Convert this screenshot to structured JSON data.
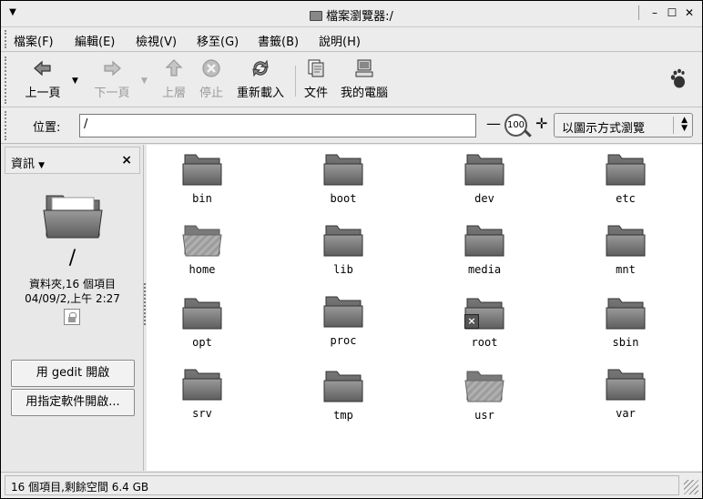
{
  "window": {
    "title": "檔案瀏覽器:/"
  },
  "menubar": {
    "items": [
      {
        "label": "檔案(F)"
      },
      {
        "label": "編輯(E)"
      },
      {
        "label": "檢視(V)"
      },
      {
        "label": "移至(G)"
      },
      {
        "label": "書籤(B)"
      },
      {
        "label": "說明(H)"
      }
    ]
  },
  "toolbar": {
    "back": "上一頁",
    "forward": "下一頁",
    "up": "上層",
    "stop": "停止",
    "reload": "重新載入",
    "documents": "文件",
    "computer": "我的電腦"
  },
  "location": {
    "label": "位置:",
    "value": "/",
    "zoom_level": "100",
    "view_mode": "以圖示方式瀏覽"
  },
  "sidepane": {
    "title": "資訊",
    "folder_name": "/",
    "info_line1": "資料夾,16 個項目",
    "info_line2": "04/09/2,上午 2:27",
    "open_with_gedit": "用 gedit 開啟",
    "open_with_other": "用指定軟件開啟..."
  },
  "items": [
    {
      "name": "bin",
      "style": "normal"
    },
    {
      "name": "boot",
      "style": "normal"
    },
    {
      "name": "dev",
      "style": "normal"
    },
    {
      "name": "etc",
      "style": "normal"
    },
    {
      "name": "home",
      "style": "home"
    },
    {
      "name": "lib",
      "style": "normal"
    },
    {
      "name": "media",
      "style": "normal"
    },
    {
      "name": "mnt",
      "style": "normal"
    },
    {
      "name": "opt",
      "style": "normal"
    },
    {
      "name": "proc",
      "style": "normal"
    },
    {
      "name": "root",
      "style": "locked"
    },
    {
      "name": "sbin",
      "style": "normal"
    },
    {
      "name": "srv",
      "style": "normal"
    },
    {
      "name": "tmp",
      "style": "normal"
    },
    {
      "name": "usr",
      "style": "home"
    },
    {
      "name": "var",
      "style": "normal"
    }
  ],
  "statusbar": {
    "text": "16 個項目,剩餘空間 6.4 GB"
  }
}
